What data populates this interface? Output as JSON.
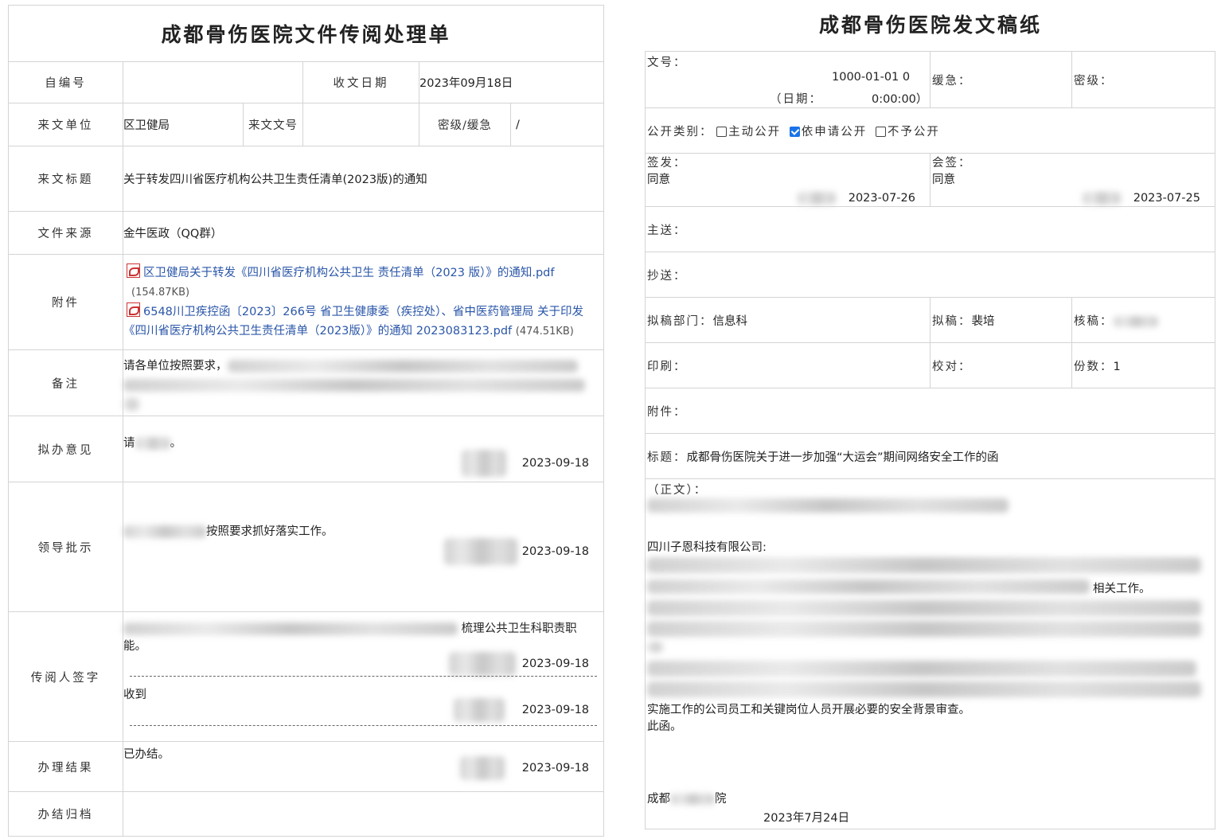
{
  "left": {
    "title": "成都骨伤医院文件传阅处理单",
    "labels": {
      "self_no": "自编号",
      "recv_date": "收文日期",
      "from_unit": "来文单位",
      "doc_no": "来文文号",
      "secret_urgency": "密级/缓急",
      "doc_title": "来文标题",
      "doc_source": "文件来源",
      "attach": "附件",
      "remark": "备注",
      "proposal": "拟办意见",
      "leader": "领导批示",
      "reader_sign": "传阅人签字",
      "result": "办理结果",
      "archive": "办结归档"
    },
    "values": {
      "self_no": "",
      "recv_date": "2023年09月18日",
      "from_unit": "区卫健局",
      "doc_no": "",
      "secret_urgency": "/",
      "doc_title": "关于转发四川省医疗机构公共卫生责任清单(2023版)的通知",
      "doc_source": "金牛医政（QQ群）",
      "attachments": [
        {
          "name": "区卫健局关于转发《四川省医疗机构公共卫生 责任清单（2023 版）》的通知.pdf",
          "size": "(154.87KB)"
        },
        {
          "name": "6548川卫疾控函〔2023〕266号 省卫生健康委（疾控处）、省中医药管理局 关于印发《四川省医疗机构公共卫生责任清单（2023版）》的通知 2023083123.pdf",
          "size": "(474.51KB)"
        }
      ],
      "remark": "请各单位按照要求，",
      "proposal": "请",
      "proposal_end": "。",
      "proposal_date": "2023-09-18",
      "leader_text": "按照要求抓好落实工作。",
      "leader_date": "2023-09-18",
      "reader1_text": "梳理公共卫生科职责职",
      "reader1_text2": "能。",
      "reader1_date": "2023-09-18",
      "reader2_text": "收到",
      "reader2_date": "2023-09-18",
      "result_text": "已办结。",
      "result_date": "2023-09-18",
      "archive": ""
    }
  },
  "right": {
    "title": "成都骨伤医院发文稿纸",
    "doc_no_label": "文号：",
    "doc_no_value": "1000-01-01 0",
    "doc_date_label": "（日期：",
    "doc_date_value": "0:00:00）",
    "urgency_label": "缓急：",
    "secret_label": "密级：",
    "public_label": "公开类别：",
    "public_options": [
      "主动公开",
      "依申请公开",
      "不予公开"
    ],
    "sign_label": "签发：",
    "sign_value": "同意",
    "sign_date": "2023-07-26",
    "cosign_label": "会签：",
    "cosign_value": "同意",
    "cosign_date": "2023-07-25",
    "main_send": "主送：",
    "copy_send": "抄送：",
    "draft_dept_label": "拟稿部门：",
    "draft_dept_value": "信息科",
    "drafter_label": "拟稿：",
    "drafter_value": "裴培",
    "checker_label": "核稿：",
    "print_label": "印刷：",
    "proof_label": "校对：",
    "copies_label": "份数：",
    "copies_value": "1",
    "attach_label": "附件：",
    "subject_label": "标题：",
    "subject_value": "成都骨伤医院关于进一步加强“大运会”期间网络安全工作的函",
    "body_label": "（正文）：",
    "recipient": "四川子恩科技有限公司:",
    "body_fragment1": "相关工作。",
    "body_last": "实施工作的公司员工和关键岗位人员开展必要的安全背景审查。",
    "body_end": "此函。",
    "footer_org": "成都",
    "footer_org_end": "院",
    "footer_date": "2023年7月24日"
  },
  "colors": {
    "checkbox_on": "#1a73e8",
    "link": "#2a56a8",
    "border": "#d4d4d4"
  }
}
